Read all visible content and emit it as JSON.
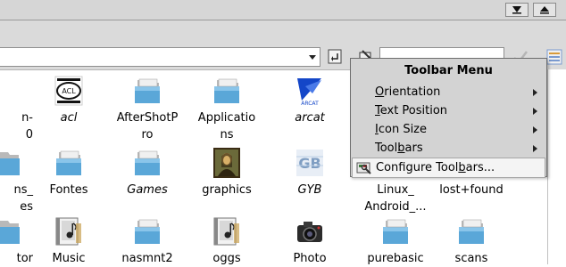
{
  "files": [
    {
      "label": "n-",
      "label2": "0",
      "icon": "file-icon",
      "italic": false
    },
    {
      "label": "acl",
      "icon": "acl-logo-icon",
      "italic": true
    },
    {
      "label": "AfterShotP",
      "label2": "ro",
      "icon": "folder-icon",
      "italic": false
    },
    {
      "label": "Applicatio",
      "label2": "ns",
      "icon": "folder-icon",
      "italic": false
    },
    {
      "label": "arcat",
      "icon": "arcat-logo-icon",
      "italic": true
    },
    {
      "label": "ns_",
      "label2": "es",
      "icon": "folder-icon",
      "italic": false
    },
    {
      "label": "Fontes",
      "icon": "folder-icon",
      "italic": false
    },
    {
      "label": "Games",
      "icon": "folder-icon",
      "italic": true
    },
    {
      "label": "graphics",
      "icon": "mona-lisa-icon",
      "italic": false
    },
    {
      "label": "GYB",
      "icon": "gyb-image-icon",
      "italic": true
    },
    {
      "label": "Linux_",
      "label2": "Android_...",
      "icon": "folder-icon",
      "italic": false
    },
    {
      "label": "lost+found",
      "icon": "folder-icon",
      "italic": false
    },
    {
      "label": "tor",
      "icon": "folder-icon",
      "italic": false
    },
    {
      "label": "Music",
      "icon": "music-folder-icon",
      "italic": false
    },
    {
      "label": "nasmnt2",
      "icon": "folder-icon",
      "italic": false
    },
    {
      "label": "oggs",
      "icon": "music-folder-icon",
      "italic": false
    },
    {
      "label": "Photo",
      "icon": "camera-icon",
      "italic": false
    },
    {
      "label": "purebasic",
      "icon": "folder-icon",
      "italic": false
    },
    {
      "label": "scans",
      "icon": "folder-icon",
      "italic": false
    }
  ],
  "toolbar_menu": {
    "title": "Toolbar Menu",
    "items": [
      {
        "pre": "",
        "u": "O",
        "post": "rientation",
        "submenu": true
      },
      {
        "pre": "",
        "u": "T",
        "post": "ext Position",
        "submenu": true
      },
      {
        "pre": "",
        "u": "I",
        "post": "con Size",
        "submenu": true
      },
      {
        "pre": "Tool",
        "u": "b",
        "post": "ars",
        "submenu": true
      },
      {
        "pre": "Configure Tool",
        "u": "b",
        "post": "ars...",
        "submenu": false
      }
    ]
  },
  "colors": {
    "folder_blue": "#5aa7d8",
    "menu_bg": "#d3d3d3",
    "toolbar_bg": "#dadada"
  }
}
